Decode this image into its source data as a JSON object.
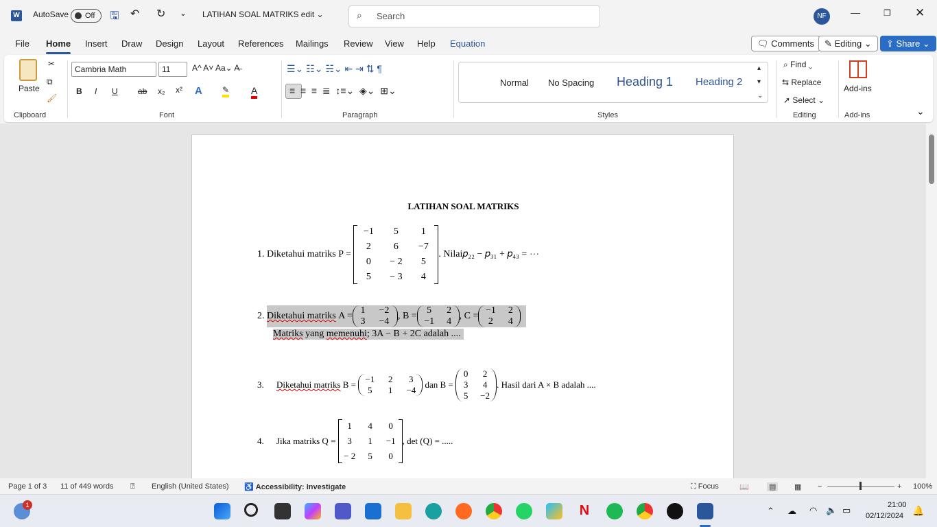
{
  "titlebar": {
    "autosave_label": "AutoSave",
    "autosave_state": "Off",
    "doc_title": "LATIHAN SOAL MATRIKS edit ⌄",
    "search_placeholder": "Search",
    "user_initials": "NF"
  },
  "tabs": [
    "File",
    "Home",
    "Insert",
    "Draw",
    "Design",
    "Layout",
    "References",
    "Mailings",
    "Review",
    "View",
    "Help",
    "Equation"
  ],
  "header_buttons": {
    "comments": "Comments",
    "editing": "Editing ⌄",
    "share": "Share ⌄"
  },
  "ribbon": {
    "clipboard": {
      "paste": "Paste",
      "label": "Clipboard"
    },
    "font": {
      "font_name": "Cambria Math",
      "font_size": "11",
      "label": "Font",
      "buttons": [
        "B",
        "I",
        "U",
        "ab",
        "x₂",
        "x²"
      ]
    },
    "paragraph": {
      "label": "Paragraph"
    },
    "styles": {
      "label": "Styles",
      "items": [
        "Normal",
        "No Spacing",
        "Heading 1",
        "Heading 2"
      ]
    },
    "editing": {
      "label": "Editing",
      "find": "Find",
      "replace": "Replace",
      "select": "Select"
    },
    "addins": {
      "button": "Add-ins",
      "label": "Add-ins"
    }
  },
  "document": {
    "title": "LATIHAN SOAL MATRIKS",
    "q1": {
      "num": "1.",
      "text": "Diketahui matriks P =",
      "matrix": [
        [
          "−1",
          "5",
          "1"
        ],
        [
          "2",
          "6",
          "−7"
        ],
        [
          "0",
          "− 2",
          "5"
        ],
        [
          "5",
          "− 3",
          "4"
        ]
      ],
      "after": ". Nilai𝑝₂₂ − 𝑝₃₁ + 𝑝₄₃ = ⋯"
    },
    "q2": {
      "num": "2.",
      "text": "Diketahui matriks",
      "a_label": "A =",
      "A": [
        [
          "1",
          "−2"
        ],
        [
          "3",
          "−4"
        ]
      ],
      "b_label": ", B =",
      "B": [
        [
          "5",
          "2"
        ],
        [
          "−1",
          "4"
        ]
      ],
      "c_label": ", C =",
      "C": [
        [
          "−1",
          "2"
        ],
        [
          "2",
          "4"
        ]
      ],
      "line2_a": "Matriks",
      "line2_b": "yang",
      "line2_c": "memenuhi",
      "line2_d": "; 3A − B + 2C adalah ...."
    },
    "q3": {
      "num": "3.",
      "text": "Diketahui matriks",
      "b_label": "B =",
      "B1": [
        [
          "−1",
          "2",
          "3"
        ],
        [
          "5",
          "1",
          "−4"
        ]
      ],
      "mid": "dan B =",
      "B2": [
        [
          "0",
          "2"
        ],
        [
          "3",
          "4"
        ],
        [
          "5",
          "−2"
        ]
      ],
      "after": ". Hasil dari A × B adalah ...."
    },
    "q4": {
      "num": "4.",
      "text": "Jika matriks Q =",
      "Q": [
        [
          "1",
          "4",
          "0"
        ],
        [
          "3",
          "1",
          "−1"
        ],
        [
          "− 2",
          "5",
          "0"
        ]
      ],
      "after": ", det (Q) = ....."
    }
  },
  "status": {
    "page": "Page 1 of 3",
    "words": "11 of 449 words",
    "language": "English (United States)",
    "accessibility": "Accessibility: Investigate",
    "focus": "Focus",
    "zoom": "100%"
  },
  "taskbar": {
    "time": "21:00",
    "date": "02/12/2024",
    "notification_badge": "1"
  }
}
